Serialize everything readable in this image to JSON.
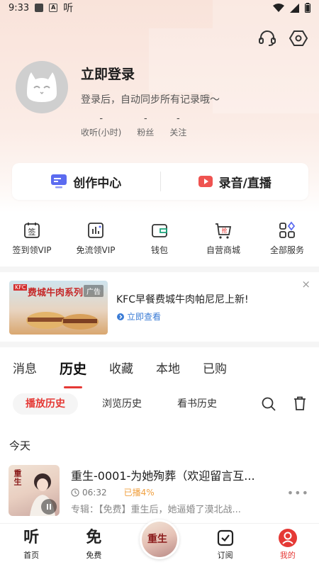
{
  "status_bar": {
    "time": "9:33",
    "extra_label": "A",
    "app_glyph": "听"
  },
  "header": {
    "headset_icon": "headset-icon",
    "settings_icon": "hexagon-settings-icon"
  },
  "profile": {
    "login_title": "立即登录",
    "login_subtitle": "登录后，自动同步所有记录哦～",
    "stats": [
      {
        "value": "-",
        "label": "收听(小时)"
      },
      {
        "value": "-",
        "label": "粉丝"
      },
      {
        "value": "-",
        "label": "关注"
      }
    ]
  },
  "creator_card": {
    "left_label": "创作中心",
    "right_label": "录音/直播",
    "left_color": "#5b6bf0",
    "right_color": "#e53935"
  },
  "services": [
    {
      "label": "签到领VIP",
      "icon": "sign-in-icon",
      "glyph": "签"
    },
    {
      "label": "免流领VIP",
      "icon": "data-chart-icon",
      "glyph": ""
    },
    {
      "label": "钱包",
      "icon": "wallet-icon",
      "glyph": ""
    },
    {
      "label": "自营商城",
      "icon": "shopping-cart-icon",
      "glyph": "抢"
    },
    {
      "label": "全部服务",
      "icon": "grid-apps-icon",
      "glyph": ""
    }
  ],
  "ad": {
    "image_brand": "KFC",
    "image_title": "费城牛肉系列",
    "badge": "广告",
    "title": "KFC早餐费城牛肉帕尼尼上新!",
    "link": "立即查看",
    "close": "×"
  },
  "tabs": [
    {
      "label": "消息",
      "active": false
    },
    {
      "label": "历史",
      "active": true
    },
    {
      "label": "收藏",
      "active": false
    },
    {
      "label": "本地",
      "active": false
    },
    {
      "label": "已购",
      "active": false
    }
  ],
  "subtabs": [
    {
      "label": "播放历史",
      "active": true
    },
    {
      "label": "浏览历史",
      "active": false
    },
    {
      "label": "看书历史",
      "active": false
    }
  ],
  "history": {
    "section_title": "今天",
    "items": [
      {
        "title": "重生-0001-为她殉葬（欢迎留言互...",
        "duration": "06:32",
        "progress": "已播4%",
        "album": "专辑：【免费】重生后，她逼婚了漠北战..."
      }
    ]
  },
  "bottom_nav": [
    {
      "label": "首页",
      "glyph": "听",
      "active": false
    },
    {
      "label": "免费",
      "glyph": "免",
      "active": false
    },
    {
      "label": "订阅",
      "glyph": "",
      "active": false
    },
    {
      "label": "我的",
      "glyph": "",
      "active": true
    }
  ],
  "accent_color": "#e53935"
}
